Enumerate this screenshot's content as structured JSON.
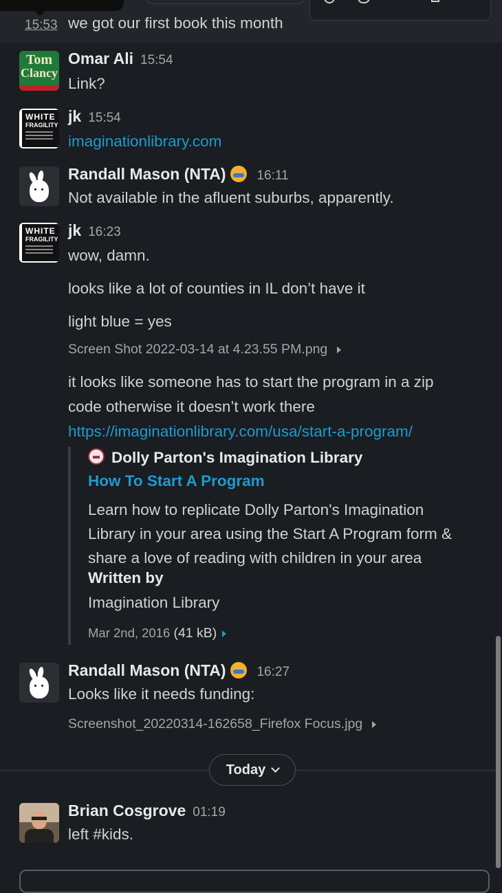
{
  "top_message": {
    "time": "15:53",
    "text": "we got our first book this month"
  },
  "messages": [
    {
      "author": "Omar Ali",
      "time": "15:54",
      "text": "Link?",
      "avatar": {
        "kind": "book-cover",
        "line1": "Tom",
        "line2": "Clancy"
      }
    },
    {
      "author": "jk",
      "time": "15:54",
      "link": "imaginationlibrary.com",
      "avatar": {
        "kind": "book-cover",
        "line1": "WHITE",
        "line2": "FRAGILITY"
      }
    },
    {
      "author": "Randall Mason (NTA)",
      "time": "16:11",
      "text": "Not available in the afluent suburbs, apparently.",
      "avatar": {
        "kind": "bunny"
      }
    },
    {
      "author": "jk",
      "time": "16:23",
      "avatar": {
        "kind": "book-cover",
        "line1": "WHITE",
        "line2": "FRAGILITY"
      },
      "lines": [
        "wow, damn.",
        "looks like a lot of counties in IL don’t have it",
        "light blue = yes"
      ],
      "file": "Screen Shot 2022-03-14 at 4.23.55 PM.png",
      "text2_line1": "it looks like someone has to start the program in a zip",
      "text2_line2": "code otherwise it doesn’t work there",
      "url": "https://imaginationlibrary.com/usa/start-a-program/",
      "unfurl": {
        "site": "Dolly Parton's Imagination Library",
        "title": "How To Start A Program",
        "desc": "Learn how to replicate Dolly Parton's Imagination Library in your area using the Start A Program form & share a love of reading with children in your area",
        "written_by_label": "Written by",
        "author": "Imagination Library",
        "date": "Mar 2nd, 2016",
        "size": "(41 kB)"
      }
    },
    {
      "author": "Randall Mason (NTA)",
      "time": "16:27",
      "text": "Looks like it needs funding:",
      "file": "Screenshot_20220314-162658_Firefox Focus.jpg",
      "avatar": {
        "kind": "bunny"
      }
    }
  ],
  "divider_label": "Today",
  "last_message": {
    "author": "Brian Cosgrove",
    "time": "01:19",
    "text": "left #kids.",
    "avatar": {
      "kind": "photo"
    }
  },
  "colors": {
    "background": "#1a1d21",
    "link": "#1d9bd1",
    "text": "#d1d2d3"
  }
}
